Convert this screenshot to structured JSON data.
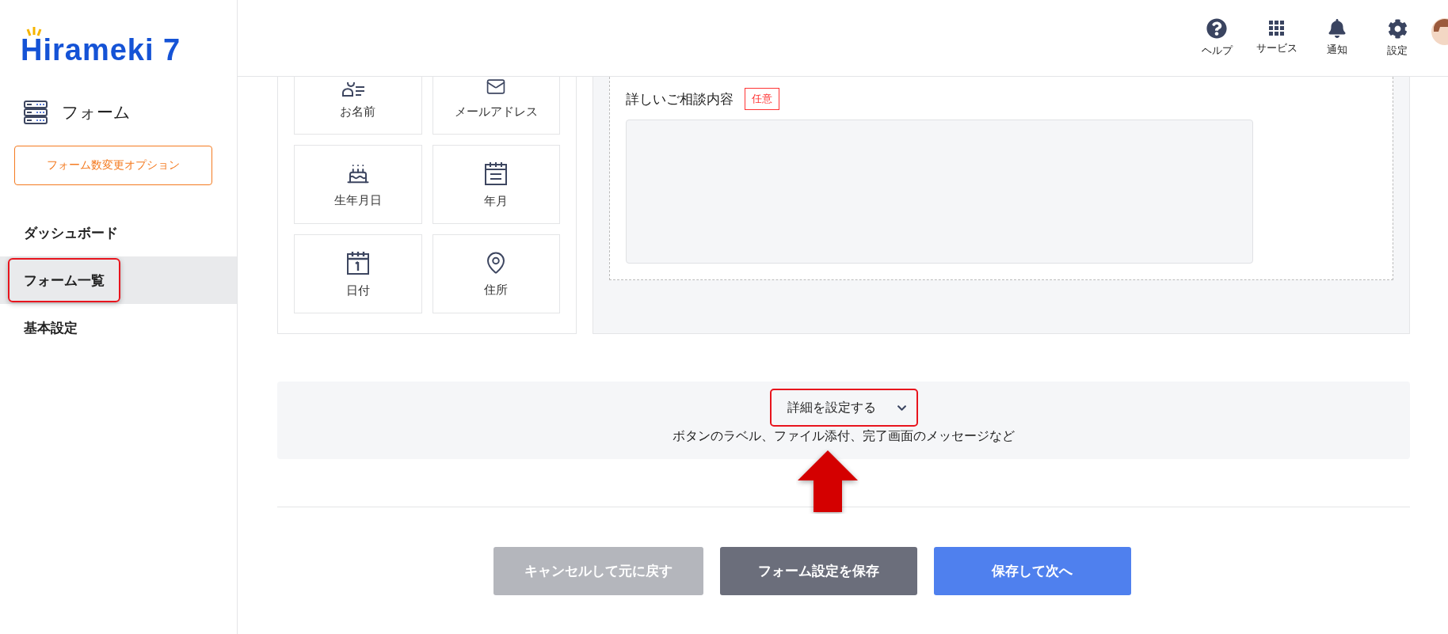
{
  "logo": {
    "text": "Hirameki 7"
  },
  "sidebar": {
    "section": "フォーム",
    "option_button": "フォーム数変更オプション",
    "items": [
      {
        "label": "ダッシュボード",
        "selected": false,
        "annotated": false
      },
      {
        "label": "フォーム一覧",
        "selected": true,
        "annotated": true
      },
      {
        "label": "基本設定",
        "selected": false,
        "annotated": false
      }
    ]
  },
  "header": {
    "items": [
      {
        "kind": "help",
        "label": "ヘルプ"
      },
      {
        "kind": "services",
        "label": "サービス"
      },
      {
        "kind": "notifications",
        "label": "通知"
      },
      {
        "kind": "settings",
        "label": "設定"
      }
    ]
  },
  "palette": {
    "items": [
      {
        "kind": "name",
        "label": "お名前"
      },
      {
        "kind": "email",
        "label": "メールアドレス"
      },
      {
        "kind": "birthday",
        "label": "生年月日"
      },
      {
        "kind": "month",
        "label": "年月"
      },
      {
        "kind": "date",
        "label": "日付"
      },
      {
        "kind": "address",
        "label": "住所"
      }
    ]
  },
  "preview": {
    "field": {
      "label": "詳しいご相談内容",
      "badge": "任意"
    }
  },
  "details": {
    "toggle": "詳細を設定する",
    "expanded": false,
    "annotated": true,
    "hint": "ボタンのラベル、ファイル添付、完了画面のメッセージなど"
  },
  "buttons": [
    {
      "kind": "cancel",
      "label": "キャンセルして元に戻す"
    },
    {
      "kind": "save",
      "label": "フォーム設定を保存"
    },
    {
      "kind": "next",
      "label": "保存して次へ"
    }
  ]
}
